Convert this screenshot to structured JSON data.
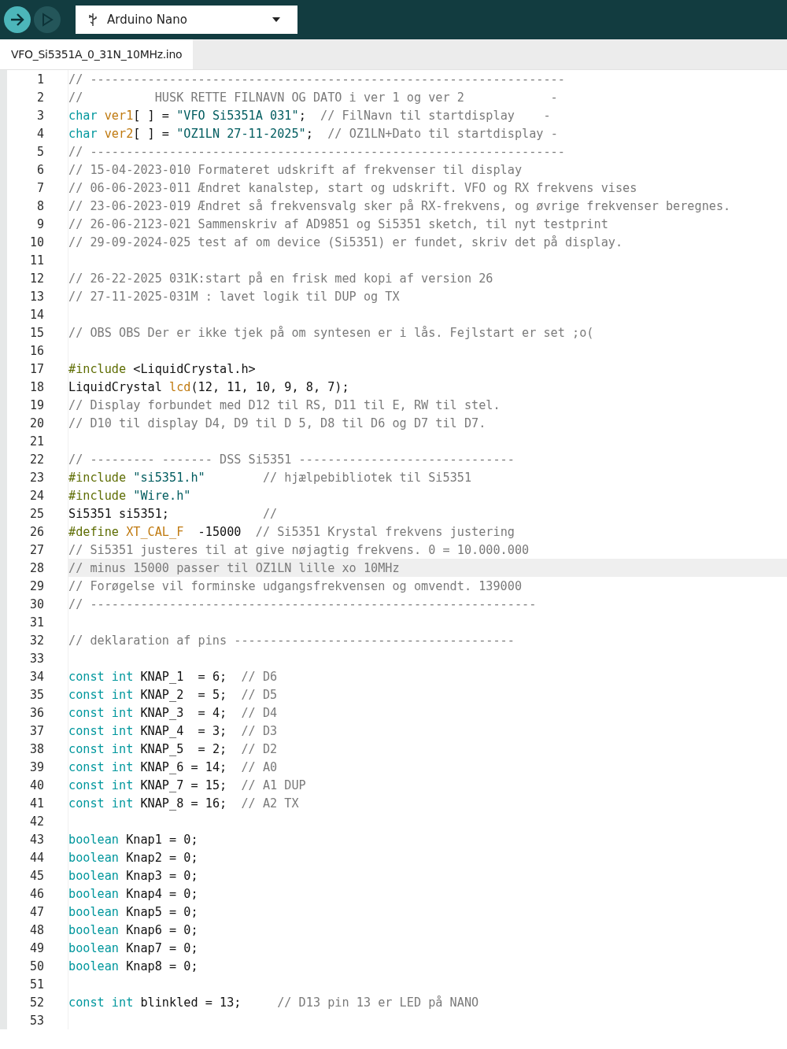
{
  "toolbar": {
    "buttons": [
      {
        "kind": "verify",
        "disabled": false
      },
      {
        "kind": "upload",
        "disabled": true
      }
    ],
    "board_selector": {
      "label": "Arduino Nano"
    }
  },
  "tabs": [
    {
      "label": "VFO_Si5351A_0_31N_10MHz.ino",
      "selected": true
    }
  ],
  "editor": {
    "lines": [
      {
        "number": "1",
        "current": false,
        "tokens": [
          {
            "kind": "comment",
            "text": "// ------------------------------------------------------------------"
          }
        ]
      },
      {
        "number": "2",
        "current": false,
        "tokens": [
          {
            "kind": "comment",
            "text": "//          HUSK RETTE FILNAVN OG DATO i ver 1 og ver 2            -"
          }
        ]
      },
      {
        "number": "3",
        "current": false,
        "tokens": [
          {
            "kind": "keyword",
            "text": "char "
          },
          {
            "kind": "name",
            "text": "ver1"
          },
          {
            "kind": "plain",
            "text": "[ ] = "
          },
          {
            "kind": "string",
            "text": "\"VFO Si5351A 031\""
          },
          {
            "kind": "plain",
            "text": ";  "
          },
          {
            "kind": "comment",
            "text": "// FilNavn til startdisplay    -"
          }
        ]
      },
      {
        "number": "4",
        "current": false,
        "tokens": [
          {
            "kind": "keyword",
            "text": "char "
          },
          {
            "kind": "name",
            "text": "ver2"
          },
          {
            "kind": "plain",
            "text": "[ ] = "
          },
          {
            "kind": "string",
            "text": "\"OZ1LN 27-11-2025\""
          },
          {
            "kind": "plain",
            "text": ";  "
          },
          {
            "kind": "comment",
            "text": "// OZ1LN+Dato til startdisplay -"
          }
        ]
      },
      {
        "number": "5",
        "current": false,
        "tokens": [
          {
            "kind": "comment",
            "text": "// ------------------------------------------------------------------"
          }
        ]
      },
      {
        "number": "6",
        "current": false,
        "tokens": [
          {
            "kind": "comment",
            "text": "// 15-04-2023-010 Formateret udskrift af frekvenser til display"
          }
        ]
      },
      {
        "number": "7",
        "current": false,
        "tokens": [
          {
            "kind": "comment",
            "text": "// 06-06-2023-011 Ændret kanalstep, start og udskrift. VFO og RX frekvens vises"
          }
        ]
      },
      {
        "number": "8",
        "current": false,
        "tokens": [
          {
            "kind": "comment",
            "text": "// 23-06-2023-019 Ændret så frekvensvalg sker på RX-frekvens, og øvrige frekvenser beregnes."
          }
        ]
      },
      {
        "number": "9",
        "current": false,
        "tokens": [
          {
            "kind": "comment",
            "text": "// 26-06-2123-021 Sammenskriv af AD9851 og Si5351 sketch, til nyt testprint"
          }
        ]
      },
      {
        "number": "10",
        "current": false,
        "tokens": [
          {
            "kind": "comment",
            "text": "// 29-09-2024-025 test af om device (Si5351) er fundet, skriv det på display."
          }
        ]
      },
      {
        "number": "11",
        "current": false
      },
      {
        "number": "12",
        "current": false,
        "tokens": [
          {
            "kind": "comment",
            "text": "// 26-22-2025 031K:start på en frisk med kopi af version 26"
          }
        ]
      },
      {
        "number": "13",
        "current": false,
        "tokens": [
          {
            "kind": "comment",
            "text": "// 27-11-2025-031M : lavet logik til DUP og TX"
          }
        ]
      },
      {
        "number": "14",
        "current": false
      },
      {
        "number": "15",
        "current": false,
        "tokens": [
          {
            "kind": "comment",
            "text": "// OBS OBS Der er ikke tjek på om syntesen er i lås. Fejlstart er set ;o("
          }
        ]
      },
      {
        "number": "16",
        "current": false
      },
      {
        "number": "17",
        "current": false,
        "tokens": [
          {
            "kind": "preproc",
            "text": "#include"
          },
          {
            "kind": "plain",
            "text": " <LiquidCrystal.h>"
          }
        ]
      },
      {
        "number": "18",
        "current": false,
        "tokens": [
          {
            "kind": "plain",
            "text": "LiquidCrystal "
          },
          {
            "kind": "name",
            "text": "lcd"
          },
          {
            "kind": "plain",
            "text": "(12, 11, 10, 9, 8, 7);"
          }
        ]
      },
      {
        "number": "19",
        "current": false,
        "tokens": [
          {
            "kind": "comment",
            "text": "// Display forbundet med D12 til RS, D11 til E, RW til stel."
          }
        ]
      },
      {
        "number": "20",
        "current": false,
        "tokens": [
          {
            "kind": "comment",
            "text": "// D10 til display D4, D9 til D 5, D8 til D6 og D7 til D7."
          }
        ]
      },
      {
        "number": "21",
        "current": false
      },
      {
        "number": "22",
        "current": false,
        "tokens": [
          {
            "kind": "comment",
            "text": "// --------- ------- DSS Si5351 ------------------------------"
          }
        ]
      },
      {
        "number": "23",
        "current": false,
        "tokens": [
          {
            "kind": "preproc",
            "text": "#include "
          },
          {
            "kind": "string",
            "text": "\"si5351.h\"        "
          },
          {
            "kind": "comment",
            "text": "// hjælpebibliotek til Si5351"
          }
        ]
      },
      {
        "number": "24",
        "current": false,
        "tokens": [
          {
            "kind": "preproc",
            "text": "#include "
          },
          {
            "kind": "string",
            "text": "\"Wire.h\""
          }
        ]
      },
      {
        "number": "25",
        "current": false,
        "tokens": [
          {
            "kind": "plain",
            "text": "Si5351 si5351;             "
          },
          {
            "kind": "comment",
            "text": "//"
          }
        ]
      },
      {
        "number": "26",
        "current": false,
        "tokens": [
          {
            "kind": "preproc",
            "text": "#define "
          },
          {
            "kind": "name",
            "text": "XT_CAL_F"
          },
          {
            "kind": "plain",
            "text": "  -15000  "
          },
          {
            "kind": "comment",
            "text": "// Si5351 Krystal frekvens justering"
          }
        ]
      },
      {
        "number": "27",
        "current": false,
        "tokens": [
          {
            "kind": "comment",
            "text": "// Si5351 justeres til at give nøjagtig frekvens. 0 = 10.000.000"
          }
        ]
      },
      {
        "number": "28",
        "current": true,
        "tokens": [
          {
            "kind": "comment",
            "text": "// minus 15000 passer til OZ1LN lille xo 10MHz"
          }
        ]
      },
      {
        "number": "29",
        "current": false,
        "tokens": [
          {
            "kind": "comment",
            "text": "// Forøgelse vil forminske udgangsfrekvensen og omvendt. 139000"
          }
        ]
      },
      {
        "number": "30",
        "current": false,
        "tokens": [
          {
            "kind": "comment",
            "text": "// --------------------------------------------------------------"
          }
        ]
      },
      {
        "number": "31",
        "current": false
      },
      {
        "number": "32",
        "current": false,
        "tokens": [
          {
            "kind": "comment",
            "text": "// deklaration af pins ---------------------------------------"
          }
        ]
      },
      {
        "number": "33",
        "current": false
      },
      {
        "number": "34",
        "current": false,
        "tokens": [
          {
            "kind": "keyword",
            "text": "const int"
          },
          {
            "kind": "plain",
            "text": " KNAP_1  = 6;  "
          },
          {
            "kind": "comment",
            "text": "// D6"
          }
        ]
      },
      {
        "number": "35",
        "current": false,
        "tokens": [
          {
            "kind": "keyword",
            "text": "const int"
          },
          {
            "kind": "plain",
            "text": " KNAP_2  = 5;  "
          },
          {
            "kind": "comment",
            "text": "// D5"
          }
        ]
      },
      {
        "number": "36",
        "current": false,
        "tokens": [
          {
            "kind": "keyword",
            "text": "const int"
          },
          {
            "kind": "plain",
            "text": " KNAP_3  = 4;  "
          },
          {
            "kind": "comment",
            "text": "// D4"
          }
        ]
      },
      {
        "number": "37",
        "current": false,
        "tokens": [
          {
            "kind": "keyword",
            "text": "const int"
          },
          {
            "kind": "plain",
            "text": " KNAP_4  = 3;  "
          },
          {
            "kind": "comment",
            "text": "// D3"
          }
        ]
      },
      {
        "number": "38",
        "current": false,
        "tokens": [
          {
            "kind": "keyword",
            "text": "const int"
          },
          {
            "kind": "plain",
            "text": " KNAP_5  = 2;  "
          },
          {
            "kind": "comment",
            "text": "// D2"
          }
        ]
      },
      {
        "number": "39",
        "current": false,
        "tokens": [
          {
            "kind": "keyword",
            "text": "const int"
          },
          {
            "kind": "plain",
            "text": " KNAP_6 = 14;  "
          },
          {
            "kind": "comment",
            "text": "// A0"
          }
        ]
      },
      {
        "number": "40",
        "current": false,
        "tokens": [
          {
            "kind": "keyword",
            "text": "const int"
          },
          {
            "kind": "plain",
            "text": " KNAP_7 = 15;  "
          },
          {
            "kind": "comment",
            "text": "// A1 DUP"
          }
        ]
      },
      {
        "number": "41",
        "current": false,
        "tokens": [
          {
            "kind": "keyword",
            "text": "const int"
          },
          {
            "kind": "plain",
            "text": " KNAP_8 = 16;  "
          },
          {
            "kind": "comment",
            "text": "// A2 TX"
          }
        ]
      },
      {
        "number": "42",
        "current": false
      },
      {
        "number": "43",
        "current": false,
        "tokens": [
          {
            "kind": "keyword",
            "text": "boolean"
          },
          {
            "kind": "plain",
            "text": " Knap1 = 0;"
          }
        ]
      },
      {
        "number": "44",
        "current": false,
        "tokens": [
          {
            "kind": "keyword",
            "text": "boolean"
          },
          {
            "kind": "plain",
            "text": " Knap2 = 0;"
          }
        ]
      },
      {
        "number": "45",
        "current": false,
        "tokens": [
          {
            "kind": "keyword",
            "text": "boolean"
          },
          {
            "kind": "plain",
            "text": " Knap3 = 0;"
          }
        ]
      },
      {
        "number": "46",
        "current": false,
        "tokens": [
          {
            "kind": "keyword",
            "text": "boolean"
          },
          {
            "kind": "plain",
            "text": " Knap4 = 0;"
          }
        ]
      },
      {
        "number": "47",
        "current": false,
        "tokens": [
          {
            "kind": "keyword",
            "text": "boolean"
          },
          {
            "kind": "plain",
            "text": " Knap5 = 0;"
          }
        ]
      },
      {
        "number": "48",
        "current": false,
        "tokens": [
          {
            "kind": "keyword",
            "text": "boolean"
          },
          {
            "kind": "plain",
            "text": " Knap6 = 0;"
          }
        ]
      },
      {
        "number": "49",
        "current": false,
        "tokens": [
          {
            "kind": "keyword",
            "text": "boolean"
          },
          {
            "kind": "plain",
            "text": " Knap7 = 0;"
          }
        ]
      },
      {
        "number": "50",
        "current": false,
        "tokens": [
          {
            "kind": "keyword",
            "text": "boolean"
          },
          {
            "kind": "plain",
            "text": " Knap8 = 0;"
          }
        ]
      },
      {
        "number": "51",
        "current": false
      },
      {
        "number": "52",
        "current": false,
        "tokens": [
          {
            "kind": "keyword",
            "text": "const int"
          },
          {
            "kind": "plain",
            "text": " blinkled = 13;     "
          },
          {
            "kind": "comment",
            "text": "// D13 pin 13 er LED på NANO"
          }
        ]
      },
      {
        "number": "53",
        "current": false
      }
    ]
  }
}
